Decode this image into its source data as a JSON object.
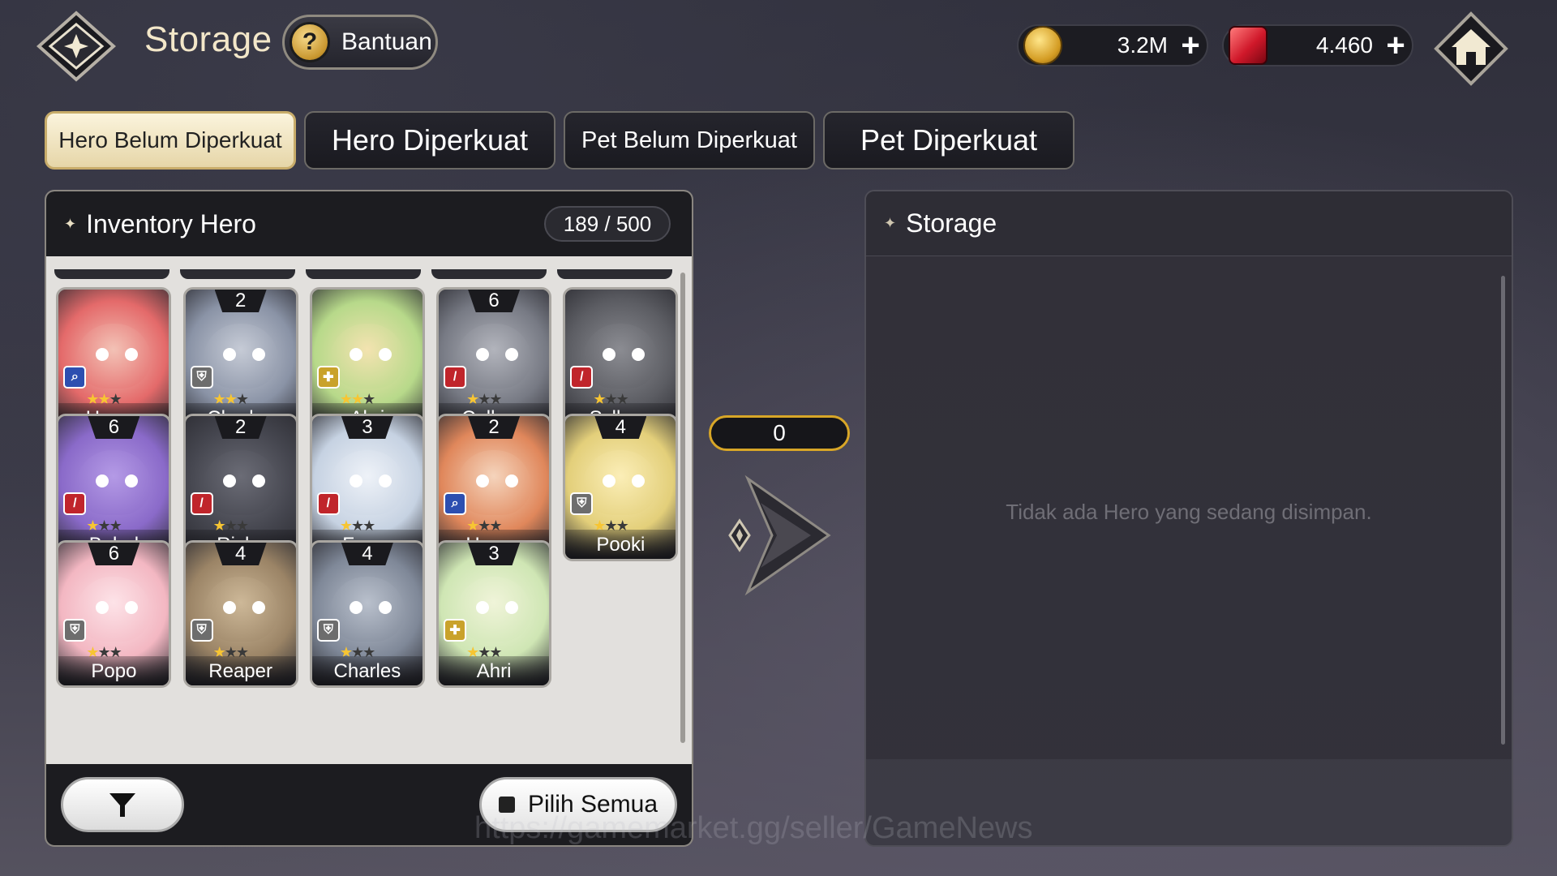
{
  "header": {
    "title": "Storage",
    "help_label": "Bantuan",
    "help_symbol": "?",
    "gold_value": "3.2M",
    "gem_value": "4.460",
    "plus": "+"
  },
  "tabs": [
    {
      "label": "Hero Belum Diperkuat",
      "active": true
    },
    {
      "label": "Hero Diperkuat",
      "active": false
    },
    {
      "label": "Pet Belum Diperkuat",
      "active": false
    },
    {
      "label": "Pet Diperkuat",
      "active": false
    }
  ],
  "inventory": {
    "title": "Inventory Hero",
    "count": "189 / 500",
    "heroes": [
      {
        "name": "Happy",
        "level": "",
        "role": "mage",
        "stars": 2
      },
      {
        "name": "Charles",
        "level": "2",
        "role": "tank",
        "stars": 2
      },
      {
        "name": "Ahri",
        "level": "",
        "role": "support",
        "stars": 2
      },
      {
        "name": "Cellops",
        "level": "6",
        "role": "warrior",
        "stars": 1
      },
      {
        "name": "Syllops",
        "level": "",
        "role": "warrior",
        "stars": 1
      },
      {
        "name": "Babel",
        "level": "6",
        "role": "warrior",
        "stars": 1
      },
      {
        "name": "Ricky",
        "level": "2",
        "role": "warrior",
        "stars": 1
      },
      {
        "name": "Frose",
        "level": "3",
        "role": "warrior",
        "stars": 1
      },
      {
        "name": "Happy",
        "level": "2",
        "role": "mage",
        "stars": 1
      },
      {
        "name": "Pooki",
        "level": "4",
        "role": "tank",
        "stars": 1
      },
      {
        "name": "Popo",
        "level": "6",
        "role": "tank",
        "stars": 1
      },
      {
        "name": "Reaper",
        "level": "4",
        "role": "tank",
        "stars": 1
      },
      {
        "name": "Charles",
        "level": "4",
        "role": "tank",
        "stars": 1
      },
      {
        "name": "Ahri",
        "level": "3",
        "role": "support",
        "stars": 1
      }
    ],
    "select_all_label": "Pilih Semua"
  },
  "transfer": {
    "selected_count": "0"
  },
  "storage": {
    "title": "Storage",
    "empty_message": "Tidak ada Hero yang sedang disimpan."
  },
  "watermark": "https://gamemarket.gg/seller/GameNews",
  "colors": {
    "accent_gold": "#d8a627",
    "tab_active": "#f3e9c6",
    "mage": "#2d4fb0",
    "warrior": "#c0252b",
    "tank": "#6d6d6d",
    "support": "#c9a22b"
  }
}
